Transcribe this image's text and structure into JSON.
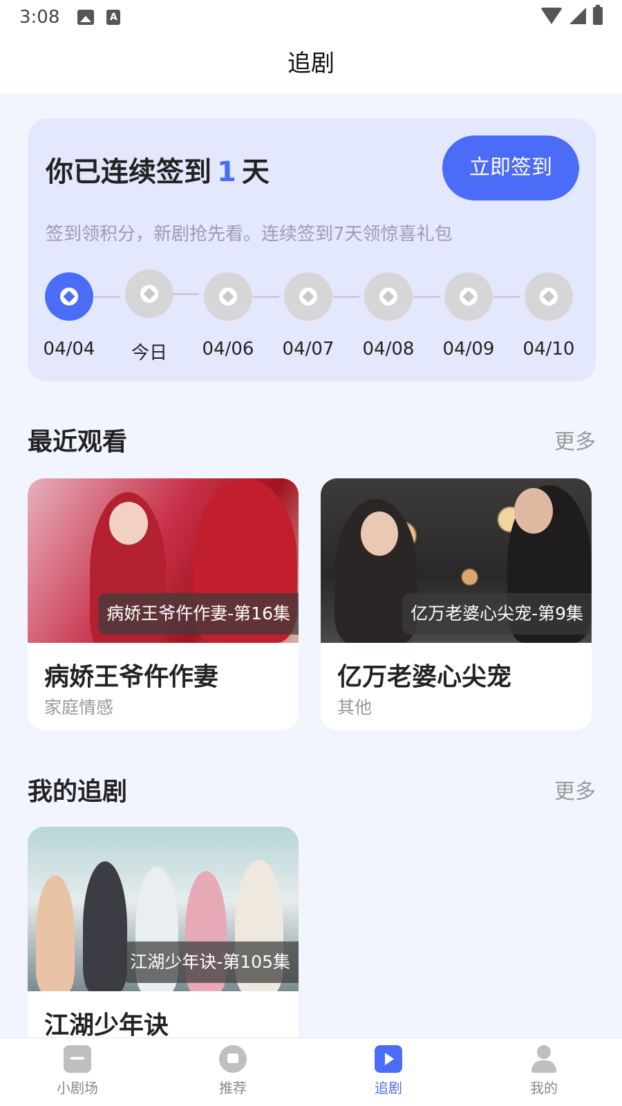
{
  "status_bar": {
    "time": "3:08"
  },
  "header": {
    "title": "追剧"
  },
  "checkin": {
    "title_prefix": "你已连续签到",
    "count": "1",
    "title_suffix": "天",
    "button_label": "立即签到",
    "description": "签到领积分，新剧抢先看。连续签到7天领惊喜礼包",
    "days": [
      {
        "label": "04/04",
        "checked": true
      },
      {
        "label": "今日",
        "checked": false
      },
      {
        "label": "04/06",
        "checked": false
      },
      {
        "label": "04/07",
        "checked": false
      },
      {
        "label": "04/08",
        "checked": false
      },
      {
        "label": "04/09",
        "checked": false
      },
      {
        "label": "04/10",
        "checked": false
      }
    ]
  },
  "recent": {
    "title": "最近观看",
    "more": "更多",
    "items": [
      {
        "episode": "病娇王爷仵作妻-第16集",
        "name": "病娇王爷仵作妻",
        "genre": "家庭情感"
      },
      {
        "episode": "亿万老婆心尖宠-第9集",
        "name": "亿万老婆心尖宠",
        "genre": "其他"
      }
    ]
  },
  "following": {
    "title": "我的追剧",
    "more": "更多",
    "items": [
      {
        "episode": "江湖少年诀-第105集",
        "name": "江湖少年诀"
      }
    ]
  },
  "bottom_nav": {
    "items": [
      {
        "label": "小剧场",
        "icon": "tv-icon",
        "active": false
      },
      {
        "label": "推荐",
        "icon": "thumbs-up-icon",
        "active": false
      },
      {
        "label": "追剧",
        "icon": "play-icon",
        "active": true
      },
      {
        "label": "我的",
        "icon": "person-icon",
        "active": false
      }
    ],
    "active_color": "#4b6cf7"
  },
  "colors": {
    "accent": "#4b6cf7",
    "background": "#f2f5fe",
    "card": "#e3e8fd"
  }
}
